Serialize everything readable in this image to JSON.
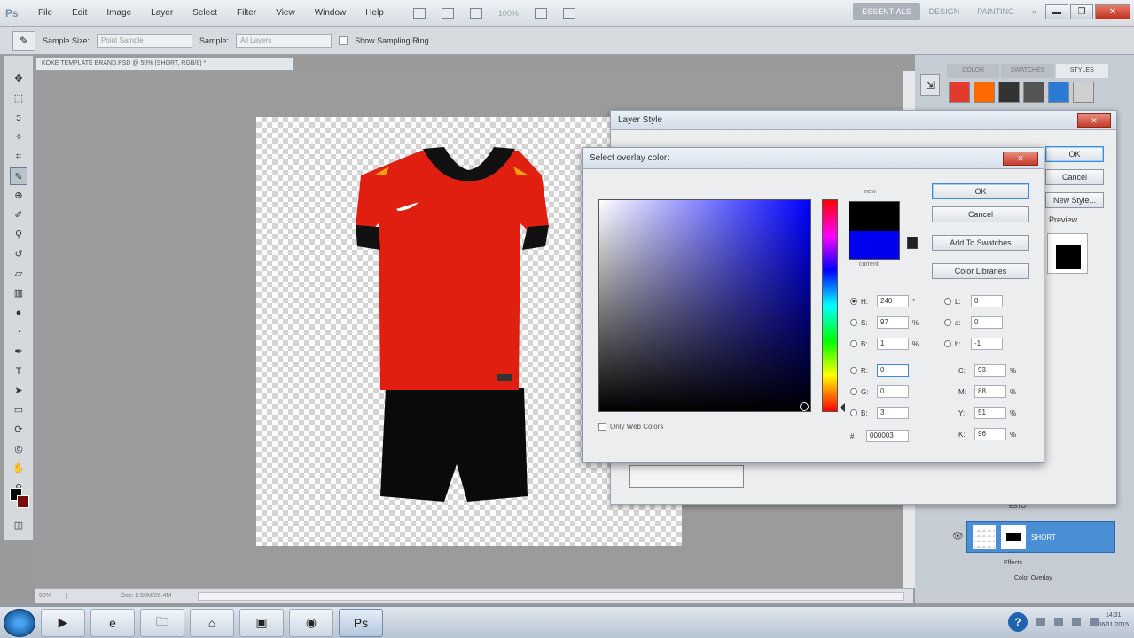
{
  "app": {
    "logo": "Ps"
  },
  "menu": [
    "File",
    "Edit",
    "Image",
    "Layer",
    "Select",
    "Filter",
    "View",
    "Window",
    "Help"
  ],
  "zoom_menu": "100%",
  "workspaces": {
    "essentials": "ESSENTIALS",
    "design": "DESIGN",
    "painting": "PAINTING",
    "more": "»"
  },
  "window_controls": {
    "minimize": "▬",
    "restore": "❐",
    "close": "✕"
  },
  "options": {
    "sample_size_label": "Sample Size:",
    "sample_size_value": "Point Sample",
    "sample_label": "Sample:",
    "sample_value": "All Layers",
    "show_ring_label": "Show Sampling Ring"
  },
  "document": {
    "tab_title": "KOKE TEMPLATE BRAND.PSD @ 50% (SHORT, RGB/8) *",
    "zoom": "50%",
    "doc_info": "Doc: 2.50M/26.4M"
  },
  "dock": {
    "tabs": [
      "COLOR",
      "SWATCHES",
      "STYLES"
    ],
    "style_swatches": [
      "#e23a2c",
      "#ff6a00",
      "#333333",
      "#555555",
      "#2a7bd6",
      "#cfcfcf"
    ],
    "layer_name": "SHORT",
    "effects_label": "Effects",
    "color_overlay_label": "Color Overlay",
    "above_layer": "ESTO"
  },
  "layer_style": {
    "title": "Layer Style",
    "close": "✕",
    "ok": "OK",
    "cancel": "Cancel",
    "new_style": "New Style...",
    "preview": "Preview"
  },
  "picker": {
    "title": "Select overlay color:",
    "close": "✕",
    "ok": "OK",
    "cancel": "Cancel",
    "add_swatches": "Add To Swatches",
    "color_libraries": "Color Libraries",
    "new_label": "new",
    "current_label": "current",
    "web_only": "Only Web Colors",
    "values": {
      "H": "240",
      "S": "97",
      "B": "1",
      "R": "0",
      "G": "0",
      "Bb": "3",
      "L": "0",
      "a": "0",
      "b": "-1",
      "C": "93",
      "M": "88",
      "Y": "51",
      "K": "96",
      "hex": "000003"
    },
    "units": {
      "deg": "°",
      "pct": "%"
    }
  },
  "taskbar": {
    "apps": [
      "media-player",
      "internet-explorer",
      "folder",
      "network",
      "powerpoint",
      "chrome",
      "photoshop"
    ],
    "time": "14:31",
    "date": "06/11/2015"
  }
}
